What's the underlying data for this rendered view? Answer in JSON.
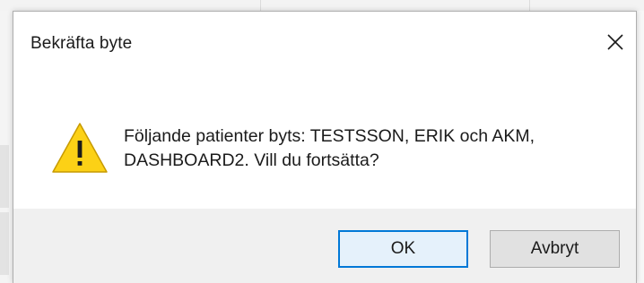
{
  "dialog": {
    "title": "Bekräfta byte",
    "close_icon": "close-icon",
    "warning_icon": "warning-icon",
    "message_line1": "Följande patienter byts: TESTSSON, ERIK och AKM,",
    "message_line2": "DASHBOARD2. Vill du fortsätta?",
    "buttons": {
      "ok_label": "OK",
      "cancel_label": "Avbryt"
    }
  },
  "colors": {
    "warning_fill": "#fcd116",
    "warning_stroke": "#c79a00",
    "accent_border": "#0078d7",
    "footer_bg": "#f0f0f0"
  }
}
